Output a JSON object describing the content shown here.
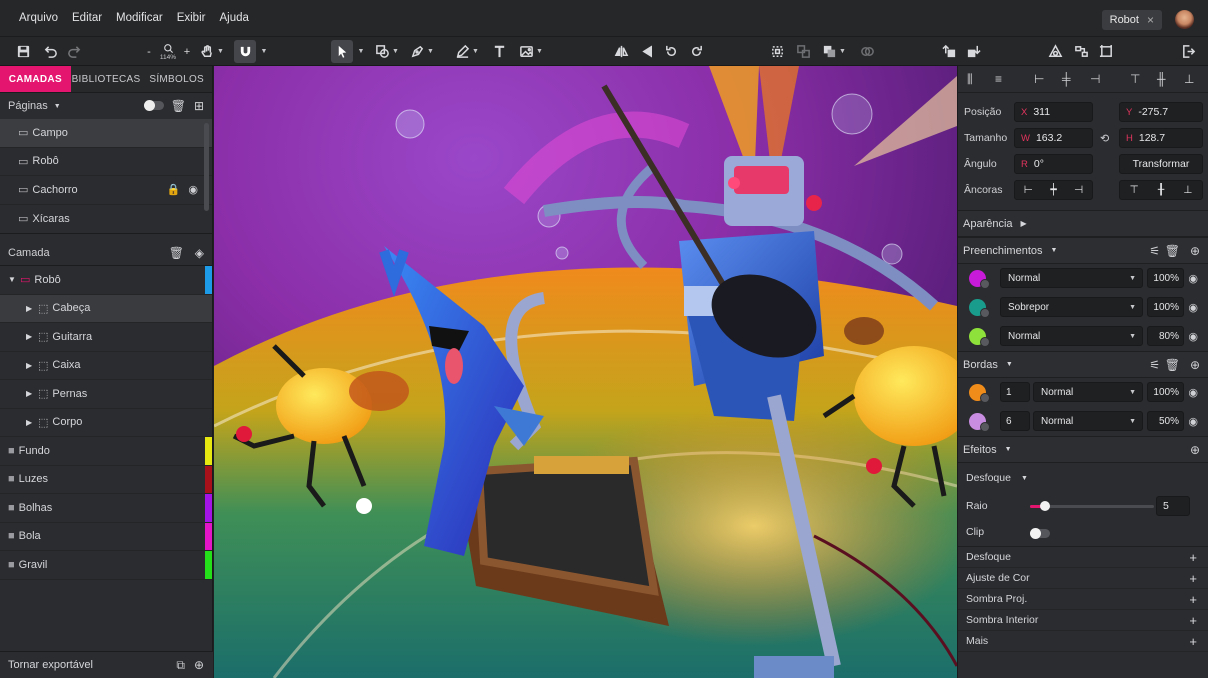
{
  "menu": [
    "Arquivo",
    "Editar",
    "Modificar",
    "Exibir",
    "Ajuda"
  ],
  "document_tab": {
    "label": "Robot",
    "close": "×"
  },
  "toolbar": {
    "zoom": "114%",
    "zoom_minus": "-",
    "zoom_plus": "+"
  },
  "left": {
    "tabs": [
      "CAMADAS",
      "BIBLIOTECAS",
      "SÍMBOLOS"
    ],
    "pages_title": "Páginas",
    "pages": [
      {
        "label": "Campo",
        "selected": true
      },
      {
        "label": "Robô"
      },
      {
        "label": "Cachorro",
        "locked": true,
        "hidden": true
      },
      {
        "label": "Xícaras"
      }
    ],
    "layer_title": "Camada",
    "layers": [
      {
        "label": "Robô",
        "level": 0,
        "type": "artboard",
        "expanded": true,
        "color": "#1e9be8"
      },
      {
        "label": "Cabeça",
        "level": 1,
        "type": "group",
        "selected": true
      },
      {
        "label": "Guitarra",
        "level": 1,
        "type": "group"
      },
      {
        "label": "Caixa",
        "level": 1,
        "type": "group"
      },
      {
        "label": "Pernas",
        "level": 1,
        "type": "group"
      },
      {
        "label": "Corpo",
        "level": 1,
        "type": "group"
      },
      {
        "label": "Fundo",
        "level": 0,
        "type": "folder",
        "color": "#e6e80f"
      },
      {
        "label": "Luzes",
        "level": 0,
        "type": "folder",
        "color": "#a8101a"
      },
      {
        "label": "Bolhas",
        "level": 0,
        "type": "folder",
        "color": "#a514e6"
      },
      {
        "label": "Bola",
        "level": 0,
        "type": "folder",
        "color": "#e414c8"
      },
      {
        "label": "Gravil",
        "level": 0,
        "type": "folder",
        "color": "#23e01a"
      }
    ],
    "footer": "Tornar exportável"
  },
  "right": {
    "position": {
      "label": "Posição",
      "x": "311",
      "y": "-275.7"
    },
    "size": {
      "label": "Tamanho",
      "w": "163.2",
      "h": "128.7"
    },
    "angle": {
      "label": "Ângulo",
      "r": "0°",
      "transform": "Transformar"
    },
    "anchors": {
      "label": "Âncoras"
    },
    "appearance": "Aparência",
    "fills_title": "Preenchimentos",
    "fills": [
      {
        "color": "#c81ad9",
        "mode": "Normal",
        "opacity": "100%"
      },
      {
        "color": "#1a9c8c",
        "mode": "Sobrepor",
        "opacity": "100%"
      },
      {
        "color": "#8ee03a",
        "mode": "Normal",
        "opacity": "80%"
      }
    ],
    "borders_title": "Bordas",
    "borders": [
      {
        "color": "#f08c1a",
        "width": "1",
        "mode": "Normal",
        "opacity": "100%"
      },
      {
        "color": "#c88ce0",
        "width": "6",
        "mode": "Normal",
        "opacity": "50%"
      }
    ],
    "effects_title": "Efeitos",
    "blur": {
      "title": "Desfoque",
      "radius_label": "Raio",
      "radius": "5",
      "radius_fraction": 0.12,
      "clip_label": "Clip"
    },
    "more_effects": [
      "Desfoque",
      "Ajuste de Cor",
      "Sombra Proj.",
      "Sombra Interior",
      "Mais"
    ]
  },
  "labels_axis": {
    "x": "X",
    "y": "Y",
    "w": "W",
    "h": "H",
    "r": "R"
  }
}
